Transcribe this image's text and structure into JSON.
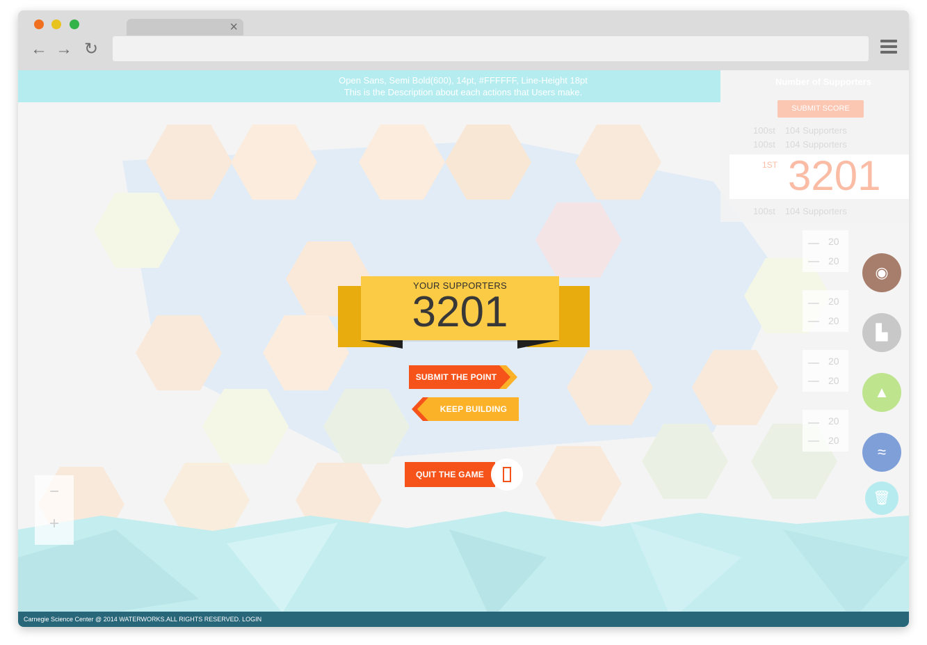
{
  "browser": {
    "traffic_lights": [
      "#f0701f",
      "#e8c21d",
      "#33b348"
    ],
    "back_icon": "back-arrow-icon",
    "forward_icon": "forward-arrow-icon",
    "reload_icon": "reload-icon",
    "tab_close": "×",
    "url": ""
  },
  "description_bar": {
    "line1": "Open Sans, Semi Bold(600), 14pt, #FFFFFF, Line-Height 18pt",
    "line2": "This is the Description about each actions that Users make."
  },
  "leaderboard": {
    "title": "Number of Supporters",
    "submit_label": "SUBMIT SCORE",
    "rows": [
      {
        "rank": "100st",
        "value": "104 Supporters"
      },
      {
        "rank": "100st",
        "value": "104 Supporters"
      }
    ],
    "first": {
      "rank": "1ST",
      "score": "3201"
    },
    "last_row": {
      "rank": "100st",
      "value": "104 Supporters"
    }
  },
  "tools": [
    {
      "a": "20",
      "b": "20",
      "icon": "camera-icon",
      "color": "#a77d6b"
    },
    {
      "a": "20",
      "b": "20",
      "icon": "city-icon",
      "color": "#c8c8c8"
    },
    {
      "a": "20",
      "b": "20",
      "icon": "forest-icon",
      "color": "#bfe48e"
    },
    {
      "a": "20",
      "b": "20",
      "icon": "river-icon",
      "color": "#7f9fd9"
    }
  ],
  "trash_icon": "trash-icon",
  "zoom": {
    "minus": "−",
    "plus": "+"
  },
  "result": {
    "label": "YOUR SUPPORTERS",
    "value": "3201"
  },
  "actions": {
    "submit": "SUBMIT THE POINT",
    "keep": "KEEP BUILDING",
    "quit": "QUIT THE GAME",
    "door_icon": "door-icon"
  },
  "footer": {
    "text": "Carnegie Science Center @ 2014 WATERWORKS.ALL RIGHTS RESERVED. LOGIN"
  },
  "colors": {
    "accent_orange": "#f6531b",
    "accent_yellow": "#fccb46",
    "description_bar": "#b4ecf0",
    "footer": "#28667a"
  }
}
